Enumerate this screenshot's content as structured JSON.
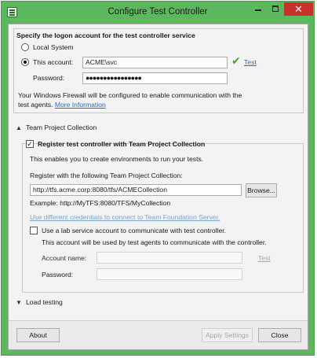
{
  "window": {
    "title": "Configure Test Controller",
    "icons": {
      "app": "app-icon",
      "minimize": "minimize-icon",
      "maximize": "maximize-icon",
      "close": "close-icon"
    },
    "close_glyph": "✕"
  },
  "logon": {
    "heading": "Specify the logon account for the test controller service",
    "local_system_label": "Local System",
    "this_account_label": "This account:",
    "account_value": "ACME\\svc",
    "password_label": "Password:",
    "password_value": "●●●●●●●●●●●●●●●●",
    "test_link": "Test",
    "firewall_text_1": "Your Windows Firewall will be configured to enable communication with the",
    "firewall_text_2": "test agents.",
    "more_info_link": "More Information"
  },
  "tpc": {
    "section_label": "Team Project Collection",
    "register_label": "Register test controller with Team Project Collection",
    "enables_text": "This enables you to create environments to run your tests.",
    "register_with_label": "Register with the following Team Project Collection:",
    "collection_value": "http://tfs.acme.corp:8080/tfs/ACMECollection",
    "browse_label": "Browse...",
    "example_text": "Example: http://MyTFS:8080/TFS/MyCollection",
    "credentials_link": "Use different credentials to connect to Team Foundation Server.",
    "lab_service_label": "Use a lab service account to communicate with test controller.",
    "lab_service_note": "This account will be used by test agents to communicate with the controller.",
    "account_name_label": "Account name:",
    "account_name_value": "",
    "password_label": "Password:",
    "password_value": "",
    "test_link": "Test"
  },
  "load_testing": {
    "section_label": "Load testing"
  },
  "footer": {
    "about_label": "About",
    "apply_label": "Apply Settings",
    "close_label": "Close"
  },
  "glyphs": {
    "expanded": "▲",
    "collapsed": "▼",
    "check": "✓",
    "checkmark": "✔"
  }
}
